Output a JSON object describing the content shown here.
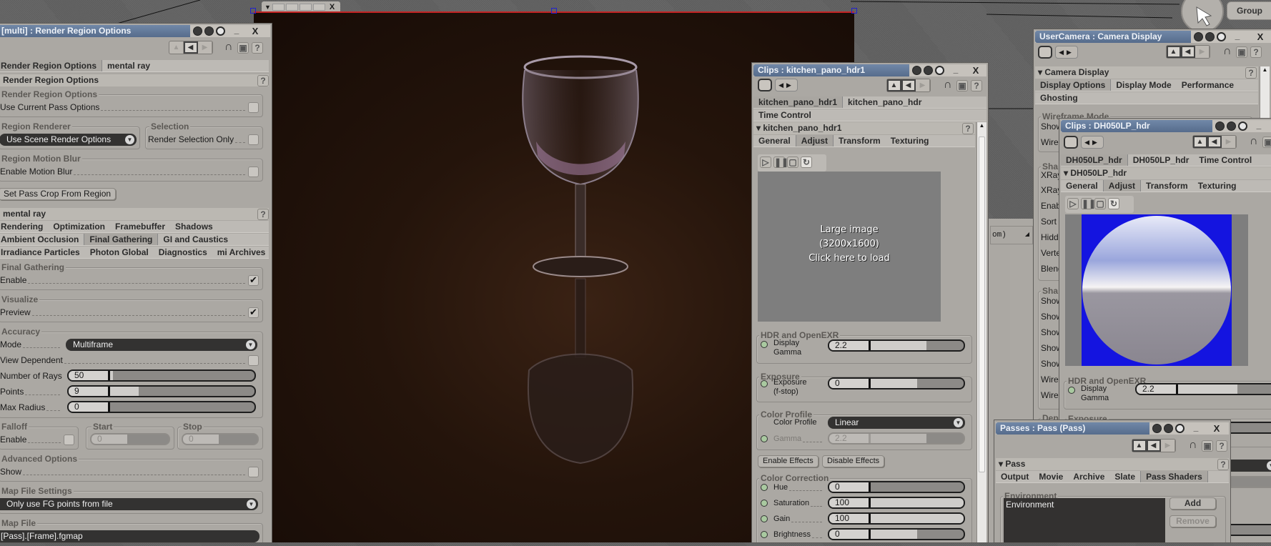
{
  "viewport": {
    "toolbar_close": "X"
  },
  "group_button": "Group",
  "bg_panel_text": "om)",
  "left_panel": {
    "title": "[multi] : Render Region Options",
    "close": "X",
    "minimize": "_",
    "tabs": [
      "Render Region Options",
      "mental ray"
    ],
    "section1": "Render Region Options",
    "g_rro": "Render Region Options",
    "use_current": "Use Current Pass Options",
    "use_current_checked": false,
    "g_region_renderer": "Region Renderer",
    "region_renderer_value": "Use Scene Render Options",
    "g_selection": "Selection",
    "render_selection_only": "Render Selection Only",
    "render_selection_checked": false,
    "g_motion_blur": "Region Motion Blur",
    "enable_motion_blur": "Enable Motion Blur",
    "motion_blur_checked": false,
    "set_pass_crop": "Set Pass Crop From Region",
    "section2": "mental ray",
    "mr_tabs_row1": [
      "Rendering",
      "Optimization",
      "Framebuffer",
      "Shadows"
    ],
    "mr_tabs_row2": [
      "Ambient Occlusion",
      "Final Gathering",
      "GI and Caustics"
    ],
    "mr_tabs_row3": [
      "Irradiance Particles",
      "Photon Global",
      "Diagnostics",
      "mi Archives"
    ],
    "fg": {
      "g_final_gathering": "Final Gathering",
      "enable": "Enable",
      "enable_checked": true,
      "g_visualize": "Visualize",
      "preview": "Preview",
      "preview_checked": true,
      "g_accuracy": "Accuracy",
      "mode_label": "Mode",
      "mode_value": "Multiframe",
      "view_dependent": "View Dependent",
      "view_dependent_checked": false,
      "rays_label": "Number of Rays",
      "rays_value": "50",
      "rays_fill": 0.02,
      "points_label": "Points",
      "points_value": "9",
      "points_fill": 0.2,
      "max_radius_label": "Max Radius",
      "max_radius_value": "0",
      "max_radius_fill": 0,
      "g_falloff": "Falloff",
      "falloff_enable": "Enable",
      "falloff_checked": false,
      "g_start": "Start",
      "start_value": "0",
      "start_fill": 0.6,
      "g_stop": "Stop",
      "stop_value": "0",
      "stop_fill": 0.6,
      "g_advanced": "Advanced Options",
      "show": "Show",
      "show_checked": false,
      "g_map_settings": "Map File Settings",
      "map_settings_value": "Only use FG points from file",
      "g_map_file": "Map File",
      "map_file_value": "[Pass].[Frame].fgmap"
    }
  },
  "clips_panel": {
    "title": "Clips : kitchen_pano_hdr1",
    "close": "X",
    "minimize": "_",
    "tabs": [
      "kitchen_pano_hdr1",
      "kitchen_pano_hdr"
    ],
    "tab_time_control": "Time Control",
    "section": "kitchen_pano_hdr1",
    "sub_tabs": [
      "General",
      "Adjust",
      "Transform",
      "Texturing"
    ],
    "image_msg": [
      "Large image",
      "(3200x1600)",
      "Click here to load"
    ],
    "g_hdr": "HDR and OpenEXR",
    "display_gamma": [
      "Display",
      "Gamma"
    ],
    "display_gamma_value": "2.2",
    "display_gamma_fill": 0.6,
    "g_exposure": "Exposure",
    "exposure": [
      "Exposure",
      "(f-stop)"
    ],
    "exposure_value": "0",
    "exposure_fill": 0.5,
    "g_color_profile": "Color Profile",
    "color_profile_label": "Color Profile",
    "color_profile_value": "Linear",
    "gamma_label": "Gamma",
    "gamma_value": "2.2",
    "gamma_fill": 0.6,
    "enable_effects": "Enable Effects",
    "disable_effects": "Disable Effects",
    "g_color_correction": "Color Correction",
    "hue_label": "Hue",
    "hue_value": "0",
    "hue_fill": 0,
    "saturation_label": "Saturation",
    "saturation_value": "100",
    "saturation_fill": 1,
    "gain_label": "Gain",
    "gain_value": "100",
    "gain_fill": 1,
    "brightness_label": "Brightness",
    "brightness_value": "0",
    "brightness_fill": 0.5
  },
  "camera_panel": {
    "title": "UserCamera : Camera Display",
    "close": "X",
    "minimize": "_",
    "section": "Camera Display",
    "tabs": [
      "Display Options",
      "Display Mode",
      "Performance"
    ],
    "tab_ghosting": "Ghosting",
    "g_wireframe": "Wireframe Mode",
    "rows_a": [
      "Show",
      "Wire"
    ],
    "g_sha": "Sha",
    "rows_b": [
      "XRay",
      "XRay",
      "Enab",
      "Sort",
      "Hidd",
      "Verte",
      "Blend"
    ],
    "g_sha2": "Sha",
    "rows_c": [
      "Show",
      "Show",
      "Show",
      "Show",
      "Show",
      "Wire",
      "Wire"
    ],
    "g_dep": "Dep"
  },
  "dh_panel": {
    "title": "Clips : DH050LP_hdr",
    "minimize": "_",
    "tabs": [
      "DH050LP_hdr",
      "DH050LP_hdr",
      "Time Control"
    ],
    "section": "DH050LP_hdr",
    "sub_tabs": [
      "General",
      "Adjust",
      "Transform",
      "Texturing"
    ],
    "g_hdr": "HDR and OpenEXR",
    "display_gamma": [
      "Display",
      "Gamma"
    ],
    "display_gamma_value": "2.2",
    "display_gamma_fill": 0.6,
    "g_exposure": "Exposure",
    "colors": {
      "preview_bg": "#1414e0"
    }
  },
  "passes_panel": {
    "title": "Passes : Pass (Pass)",
    "close": "X",
    "minimize": "_",
    "section": "Pass",
    "tabs": [
      "Output",
      "Movie",
      "Archive",
      "Slate",
      "Pass Shaders"
    ],
    "g_environment": "Environment",
    "list_items": [
      "Environment"
    ],
    "add": "Add",
    "remove": "Remove"
  }
}
